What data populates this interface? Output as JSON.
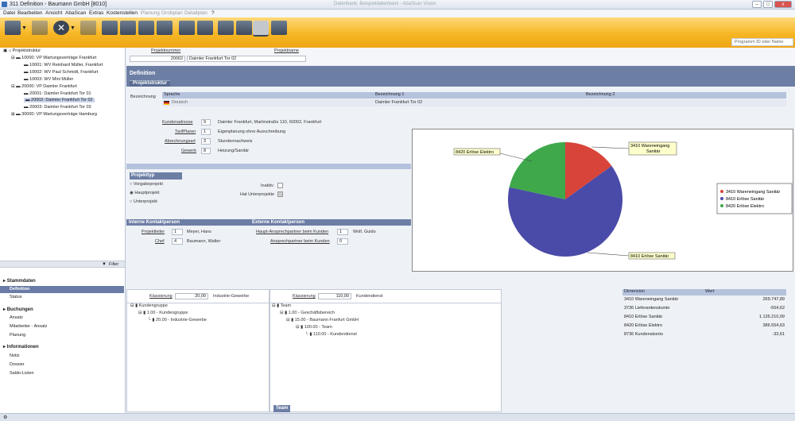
{
  "window": {
    "title": "311 Definition - Baumann GmbH [8010]",
    "center_title": "Datenbank: Beispieldatenbank - AbaScan Vision"
  },
  "menu": [
    "Datei",
    "Bearbeiten",
    "Ansicht",
    "AbaScan",
    "Extras",
    "Kostenstellen",
    "Planung",
    "Grobplan",
    "Detailplan",
    "?"
  ],
  "search": {
    "placeholder": "Programm ID oder Name"
  },
  "tree": {
    "root": "Projektstruktur",
    "items": [
      "10000: VP Wartungsverträge Frankfurt",
      "10001: WV Reinhard Müller, Frankfurt",
      "10002: WV Paul Schmidt, Frankfurt",
      "10003: WV Mini Müller",
      "20000: VP Daimler Frankfurt",
      "20001: Daimler Frankfurt Tor 01",
      "20002: Daimler Frankfurt Tor 02",
      "20003: Daimler Frankfurt Tor 03",
      "30000: VP Wartungsverträge Hamburg"
    ]
  },
  "filter": "Filter",
  "nav": {
    "stammdaten": "Stammdaten",
    "definition": "Definition",
    "status": "Status",
    "buchungen": "Buchungen",
    "ansatz": "Ansatz",
    "mitarbeiter": "Mitarbeiter - Ansatz",
    "planung": "Planung",
    "informationen": "Informationen",
    "notiz": "Notiz",
    "dossier": "Dossier",
    "saldo": "Saldo-Listen"
  },
  "project": {
    "nr_label": "Projektnummer",
    "nr": "20002",
    "frame_label": "Projektname",
    "name": "Daimler Frankfurt Tor 02"
  },
  "section": {
    "title": "Definition",
    "tab": "Projektstruktur"
  },
  "bez": {
    "label": "Bezeichnung",
    "col1": "Sprache",
    "col2": "Bezeichnung 1",
    "col3": "Bezeichnung 2",
    "lang": "Deutsch",
    "val": "Daimler Frankfurt Tor 02"
  },
  "fields": [
    {
      "label": "Kundenadresse",
      "num": "9",
      "text": "Daimler Frankfurt, Martinstraße 110, 60002, Frankfurt"
    },
    {
      "label": "TarifPlaner",
      "num": "1",
      "text": "Eigenplanung ohne Ausschreibung"
    },
    {
      "label": "Abrechnungsart",
      "num": "3",
      "text": "Stundennachweis"
    },
    {
      "label": "Gewerk",
      "num": "8",
      "text": "Heizung/Sanitär"
    }
  ],
  "projekttyp": {
    "title": "Projekttyp",
    "opts": [
      "Vorgabeprojekt",
      "Hauptprojekt",
      "Unterprojekt"
    ],
    "inaktiv": "Inaktiv",
    "hat": "Hat Unterprojekte"
  },
  "kontakt": {
    "int_title": "Interne Kontaktperson",
    "ext_title": "Externe Kontaktperson",
    "pl_label": "Projektleiter",
    "pl_num": "1",
    "pl": "Meyer, Hans",
    "chef_label": "Chef",
    "chef_num": "4",
    "chef": "Baumann, Walter",
    "hk_label": "Haupt-Ansprechpartner beim Kunden",
    "hk_num": "1",
    "hk": "Wolf, Guido",
    "ak_label": "Ansprechpartner beim Kunden",
    "ak_num": "0"
  },
  "chart_data": {
    "type": "pie",
    "values": [
      269747.89,
      1135210.09,
      386554.63
    ],
    "labels": [
      "3410 Wareneingang Sanitär",
      "8410 Erlöse Sanitär",
      "8420 Erlöse Elektro"
    ],
    "colors": [
      "#d9443a",
      "#4a4aa8",
      "#3ea84a"
    ],
    "legend": "right",
    "callouts": [
      "3410 Wareneingang Sanitär",
      "8410 Erlöse Sanitär",
      "8420 Erlöse Elektro"
    ]
  },
  "klass1": {
    "label": "Klassierung",
    "val": "20,00",
    "text": "Industrie-Gewerbe",
    "tree": [
      "Kundengruppe",
      "1.00 - Kundengruppe",
      "20.00 - Industrie-Gewerbe"
    ]
  },
  "klass2": {
    "label": "Klassierung",
    "val": "110,00",
    "text": "Kundendienst",
    "tree": [
      "Team",
      "1.00 - Geschäftsbereich",
      "15.00 - Baumann Franfurt GmbH",
      "100.00 - Team",
      "110.00 - Kundendienst"
    ],
    "tab": "Team"
  },
  "table": {
    "col1": "Dimension",
    "col2": "Wert",
    "rows": [
      [
        "3410 Wareneingang Sanitär",
        "269.747,89"
      ],
      [
        "3736 Lieferantenskonto",
        "-554,62"
      ],
      [
        "8410 Erlöse Sanitär",
        "1.135.210,09"
      ],
      [
        "8420 Erlöse Elektro",
        "386.554,63"
      ],
      [
        "8736 Kundenskonto",
        "-33,61"
      ]
    ]
  }
}
